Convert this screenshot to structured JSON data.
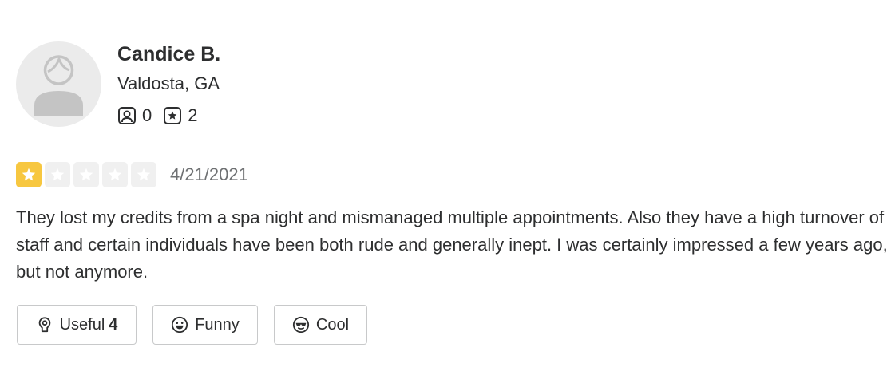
{
  "reviewer": {
    "name": "Candice B.",
    "location": "Valdosta, GA",
    "friends_count": "0",
    "reviews_count": "2"
  },
  "review": {
    "rating": 1,
    "max_rating": 5,
    "date": "4/21/2021",
    "text": "They lost my credits from a spa night and mismanaged multiple appointments. Also they have a high turnover of staff and certain individuals have been both rude and generally inept. I was certainly impressed a few years ago, but not anymore."
  },
  "reactions": {
    "useful_label": "Useful",
    "useful_count": "4",
    "funny_label": "Funny",
    "cool_label": "Cool"
  },
  "colors": {
    "star_active": "#f7c740",
    "star_inactive": "#f0f0f0",
    "text": "#2d2e2f",
    "muted": "#6e7072"
  },
  "icons": {
    "friends": "friends-icon",
    "reviews": "star-box-icon",
    "useful": "lightbulb-icon",
    "funny": "smile-icon",
    "cool": "sunglasses-icon"
  }
}
